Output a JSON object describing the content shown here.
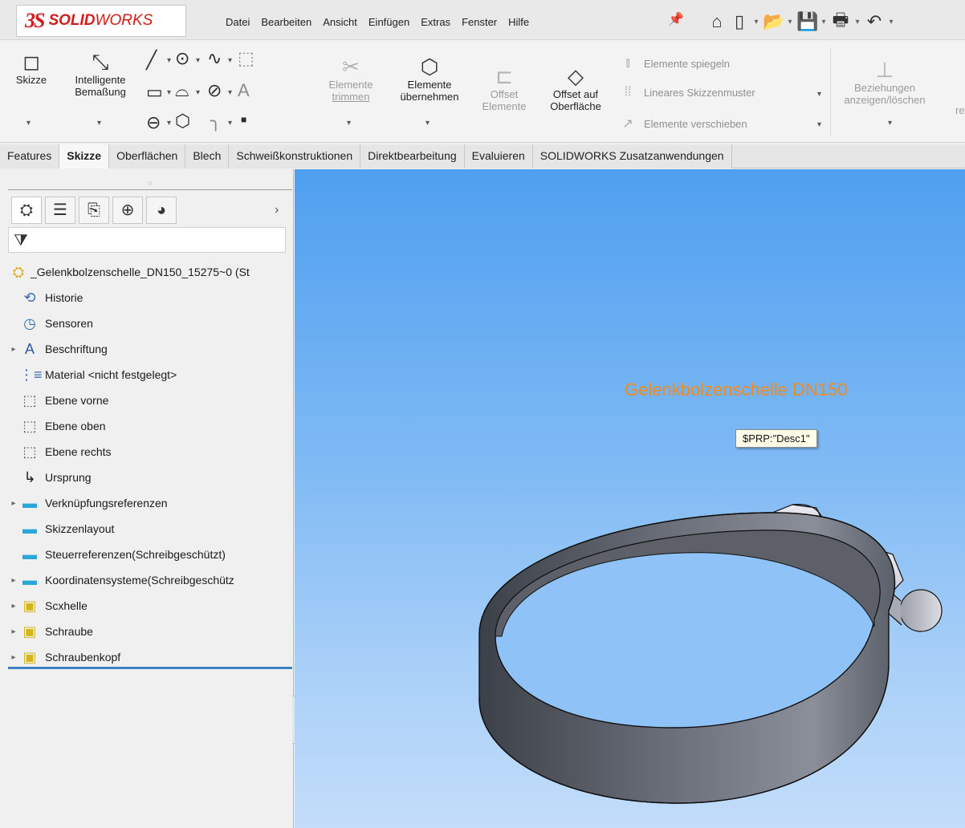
{
  "app": {
    "logo_mark": "3S",
    "logo_brand_bold": "SOLID",
    "logo_brand_light": "WORKS"
  },
  "menu": [
    "Datei",
    "Bearbeiten",
    "Ansicht",
    "Einfügen",
    "Extras",
    "Fenster",
    "Hilfe"
  ],
  "ribbon": {
    "skizze": "Skizze",
    "bemassung_1": "Intelligente",
    "bemassung_2": "Bemaßung",
    "trimmen_1": "Elemente",
    "trimmen_2": "trimmen",
    "uebernehmen_1": "Elemente",
    "uebernehmen_2": "übernehmen",
    "offset_1": "Offset",
    "offset_2": "Elemente",
    "offset_ofl_1": "Offset auf",
    "offset_ofl_2": "Oberfläche",
    "spiegeln": "Elemente spiegeln",
    "muster": "Lineares Skizzenmuster",
    "verschieben": "Elemente verschieben",
    "bez_1": "Beziehungen",
    "bez_2": "anzeigen/löschen",
    "trunc": "re"
  },
  "tabs": [
    {
      "label": "Features",
      "active": false
    },
    {
      "label": "Skizze",
      "active": true
    },
    {
      "label": "Oberflächen",
      "active": false
    },
    {
      "label": "Blech",
      "active": false
    },
    {
      "label": "Schweißkonstruktionen",
      "active": false
    },
    {
      "label": "Direktbearbeitung",
      "active": false
    },
    {
      "label": "Evaluieren",
      "active": false
    },
    {
      "label": "SOLIDWORKS Zusatzanwendungen",
      "active": false
    }
  ],
  "tree": {
    "root": "_Gelenkbolzenschelle_DN150_15275~0  (St",
    "items": [
      {
        "label": "Historie",
        "icon": "history-icon",
        "expandable": false
      },
      {
        "label": "Sensoren",
        "icon": "sensor-icon",
        "expandable": false
      },
      {
        "label": "Beschriftung",
        "icon": "annotation-icon",
        "expandable": true
      },
      {
        "label": "Material <nicht festgelegt>",
        "icon": "material-icon",
        "expandable": false
      },
      {
        "label": "Ebene vorne",
        "icon": "plane-icon",
        "expandable": false
      },
      {
        "label": "Ebene oben",
        "icon": "plane-icon",
        "expandable": false
      },
      {
        "label": "Ebene rechts",
        "icon": "plane-icon",
        "expandable": false
      },
      {
        "label": "Ursprung",
        "icon": "origin-icon",
        "expandable": false
      },
      {
        "label": "Verknüpfungsreferenzen",
        "icon": "folder-icon",
        "expandable": true
      },
      {
        "label": "Skizzenlayout",
        "icon": "folder-icon",
        "expandable": false
      },
      {
        "label": "Steuerreferenzen(Schreibgeschützt)",
        "icon": "folder-icon",
        "expandable": false
      },
      {
        "label": "Koordinatensysteme(Schreibgeschütz",
        "icon": "folder-icon",
        "expandable": true
      },
      {
        "label": "Scxhelle",
        "icon": "part-icon",
        "expandable": true
      },
      {
        "label": "Schraube",
        "icon": "part-icon",
        "expandable": true
      },
      {
        "label": "Schraubenkopf",
        "icon": "part-icon",
        "expandable": true
      }
    ]
  },
  "viewport": {
    "title": "Gelenkbolzenschelle DN150",
    "tooltip": "$PRP:\"Desc1\""
  },
  "colors": {
    "title": "#f28a1c",
    "logo": "#d31d1d",
    "accent": "#3b82c4"
  }
}
